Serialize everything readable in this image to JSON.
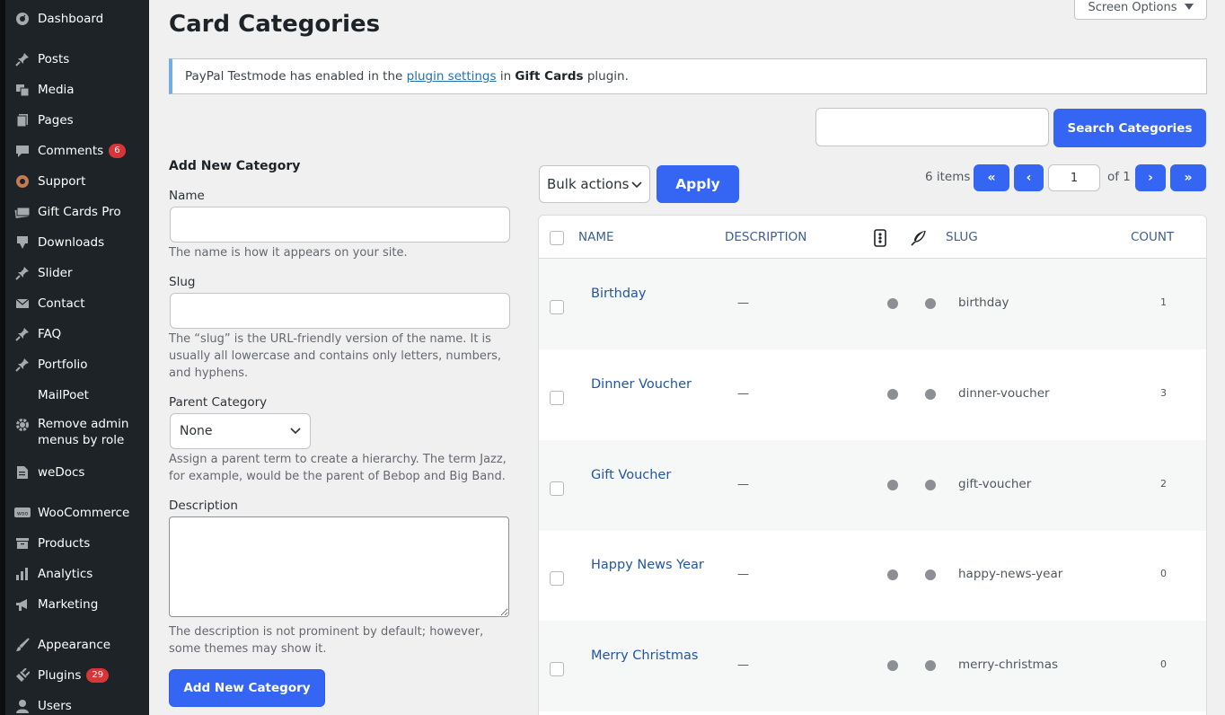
{
  "sidebar": {
    "items": [
      {
        "label": "Dashboard",
        "icon": "dashboard-icon"
      },
      {
        "label": "Posts",
        "icon": "pin-icon"
      },
      {
        "label": "Media",
        "icon": "media-icon"
      },
      {
        "label": "Pages",
        "icon": "pages-icon"
      },
      {
        "label": "Comments",
        "icon": "comment-icon",
        "badge": "6"
      },
      {
        "label": "Support",
        "icon": "support-icon"
      },
      {
        "label": "Gift Cards Pro",
        "icon": "gift-cards-icon"
      },
      {
        "label": "Downloads",
        "icon": "download-icon"
      },
      {
        "label": "Slider",
        "icon": "pin-icon"
      },
      {
        "label": "Contact",
        "icon": "mail-icon"
      },
      {
        "label": "FAQ",
        "icon": "pin-icon"
      },
      {
        "label": "Portfolio",
        "icon": "pin-icon"
      },
      {
        "label": "MailPoet",
        "icon": ""
      },
      {
        "label": "Remove admin",
        "label2": "menus by role",
        "icon": "gear-icon"
      },
      {
        "label": "weDocs",
        "icon": "document-icon"
      },
      {
        "label": "WooCommerce",
        "icon": "woo-icon"
      },
      {
        "label": "Products",
        "icon": "archive-icon"
      },
      {
        "label": "Analytics",
        "icon": "bar-chart-icon"
      },
      {
        "label": "Marketing",
        "icon": "megaphone-icon"
      },
      {
        "label": "Appearance",
        "icon": "paintbrush-icon"
      },
      {
        "label": "Plugins",
        "icon": "plug-icon",
        "badge": "29"
      },
      {
        "label": "Users",
        "icon": "user-icon"
      }
    ]
  },
  "header": {
    "title": "Card Categories",
    "screen_options": "Screen Options"
  },
  "notice": {
    "text_before": "PayPal Testmode has enabled in the ",
    "link": "plugin settings",
    "text_mid": " in ",
    "bold": "Gift Cards",
    "text_after": " plugin."
  },
  "search": {
    "placeholder": "",
    "button": "Search Categories"
  },
  "form": {
    "heading": "Add New Category",
    "name_label": "Name",
    "name_help": "The name is how it appears on your site.",
    "slug_label": "Slug",
    "slug_help": "The “slug” is the URL-friendly version of the name. It is usually all lowercase and contains only letters, numbers, and hyphens.",
    "parent_label": "Parent Category",
    "parent_value": "None",
    "parent_help": "Assign a parent term to create a hierarchy. The term Jazz, for example, would be the parent of Bebop and Big Band.",
    "description_label": "Description",
    "description_help": "The description is not prominent by default; however, some themes may show it.",
    "submit": "Add New Category"
  },
  "toolbar": {
    "bulk_actions": "Bulk actions",
    "apply": "Apply",
    "items_count": "6 items",
    "first": "«",
    "prev": "‹",
    "current_page": "1",
    "of_pages": "of 1",
    "next": "›",
    "last": "»"
  },
  "table": {
    "headers": {
      "name": "NAME",
      "description": "DESCRIPTION",
      "slug": "SLUG",
      "count": "COUNT"
    },
    "rows": [
      {
        "name": "Birthday",
        "description": "—",
        "slug": "birthday",
        "count": "1"
      },
      {
        "name": "Dinner Voucher",
        "description": "—",
        "slug": "dinner-voucher",
        "count": "3"
      },
      {
        "name": "Gift Voucher",
        "description": "—",
        "slug": "gift-voucher",
        "count": "2"
      },
      {
        "name": "Happy News Year",
        "description": "—",
        "slug": "happy-news-year",
        "count": "0"
      },
      {
        "name": "Merry Christmas",
        "description": "—",
        "slug": "merry-christmas",
        "count": "0"
      }
    ]
  },
  "colors": {
    "accent": "#3465f3",
    "sidebar_bg": "#1d2327",
    "notice_border": "#72aee6",
    "badge": "#d63638",
    "link": "#2255a4"
  }
}
